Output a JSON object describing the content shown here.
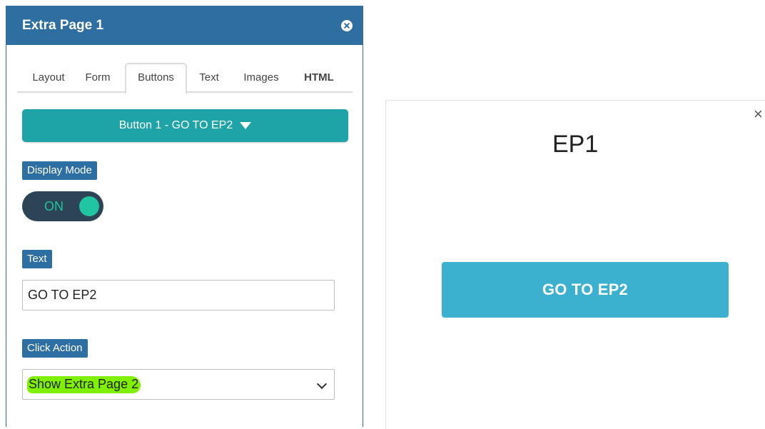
{
  "panel": {
    "title": "Extra Page 1",
    "tabs": [
      {
        "label": "Layout",
        "active": false
      },
      {
        "label": "Form",
        "active": false
      },
      {
        "label": "Buttons",
        "active": true
      },
      {
        "label": "Text",
        "active": false
      },
      {
        "label": "Images",
        "active": false
      },
      {
        "label": "HTML",
        "active": false
      }
    ],
    "button_selector": "Button 1 - GO TO EP2",
    "display_mode": {
      "label": "Display Mode",
      "toggle_text": "ON",
      "on": true
    },
    "text_field": {
      "label": "Text",
      "value": "GO TO EP2"
    },
    "click_action": {
      "label": "Click Action",
      "selected": "Show Extra Page 2"
    }
  },
  "preview": {
    "close_glyph": "×",
    "title": "EP1",
    "button_label": "GO TO EP2"
  },
  "colors": {
    "header": "#2e6ea0",
    "teal_button": "#1ea4a6",
    "label_tag": "#2d6ea3",
    "toggle_track": "#2d4356",
    "toggle_on": "#20c5a1",
    "highlight": "#7ef000",
    "cta": "#3bb1cf"
  },
  "icons": {
    "panel_close": "close-circle-icon",
    "selector_caret": "caret-down-icon",
    "select_chevron": "chevron-down-icon",
    "preview_close": "close-icon"
  }
}
